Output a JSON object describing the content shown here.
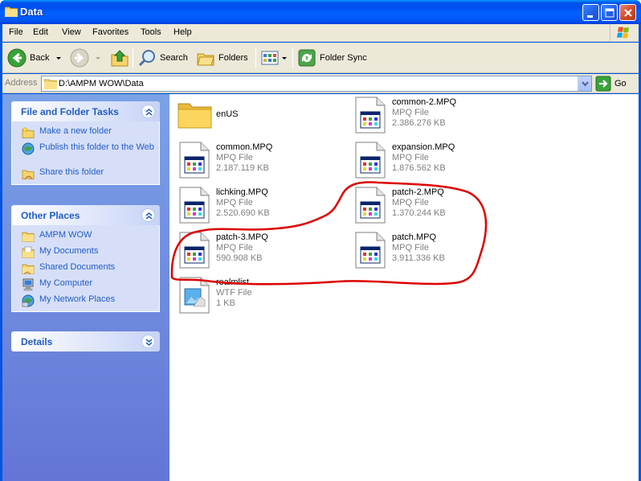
{
  "window": {
    "title": "Data"
  },
  "menu": [
    "File",
    "Edit",
    "View",
    "Favorites",
    "Tools",
    "Help"
  ],
  "toolbar": {
    "back_label": "Back",
    "search_label": "Search",
    "folders_label": "Folders",
    "foldersync_label": "Folder Sync"
  },
  "address": {
    "label": "Address",
    "path": "D:\\AMPM WOW\\Data",
    "go_label": "Go"
  },
  "sidebar": {
    "tasks": {
      "title": "File and Folder Tasks",
      "items": [
        "Make a new folder",
        "Publish this folder to the Web",
        "Share this folder"
      ]
    },
    "places": {
      "title": "Other Places",
      "items": [
        "AMPM WOW",
        "My Documents",
        "Shared Documents",
        "My Computer",
        "My Network Places"
      ]
    },
    "details": {
      "title": "Details"
    }
  },
  "files": [
    {
      "name": "enUS",
      "type": "",
      "size": "",
      "icon": "folder-icon"
    },
    {
      "name": "common-2.MPQ",
      "type": "MPQ File",
      "size": "2.386.276 KB",
      "icon": "mpq-file-icon"
    },
    {
      "name": "common.MPQ",
      "type": "MPQ File",
      "size": "2.187.119 KB",
      "icon": "mpq-file-icon"
    },
    {
      "name": "expansion.MPQ",
      "type": "MPQ File",
      "size": "1.876.562 KB",
      "icon": "mpq-file-icon"
    },
    {
      "name": "lichking.MPQ",
      "type": "MPQ File",
      "size": "2.520.690 KB",
      "icon": "mpq-file-icon"
    },
    {
      "name": "patch-2.MPQ",
      "type": "MPQ File",
      "size": "1.370.244 KB",
      "icon": "mpq-file-icon"
    },
    {
      "name": "patch-3.MPQ",
      "type": "MPQ File",
      "size": "590.908 KB",
      "icon": "mpq-file-icon"
    },
    {
      "name": "patch.MPQ",
      "type": "MPQ File",
      "size": "3.911.336 KB",
      "icon": "mpq-file-icon"
    },
    {
      "name": "realmlist",
      "type": "WTF File",
      "size": "1 KB",
      "icon": "wtf-file-icon"
    }
  ],
  "colors": {
    "titlebar": "#0054e3",
    "sidebar_link": "#215dc6",
    "annotation": "#dd0000"
  }
}
